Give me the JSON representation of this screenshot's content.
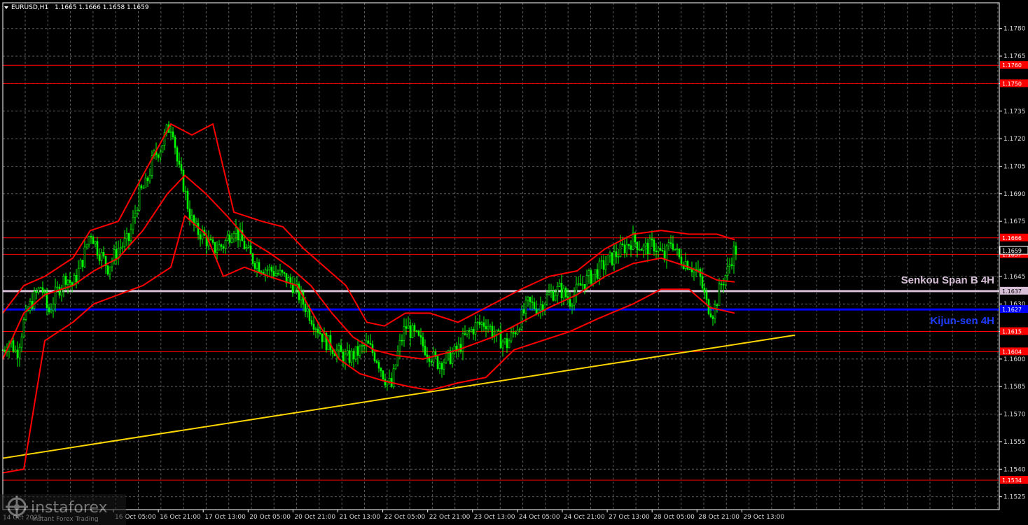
{
  "header": {
    "symbol": "EURUSD,H1",
    "ohlc": "1.1665 1.1666 1.1658 1.1659"
  },
  "watermark": {
    "brand": "instaforex",
    "tagline": "Instant Forex Trading",
    "partial_date": "14 Oct 2025"
  },
  "colors": {
    "background": "#000000",
    "grid": "#5a5a5a",
    "axis": "#ffffff",
    "candle_bull": "#00ff00",
    "candle_bear": "#00ff00",
    "bollinger": "#ff0000",
    "support_level": "#ff0000",
    "senkou": "#d8bfd8",
    "kijun": "#0000ff",
    "trendline": "#ffd700"
  },
  "chart_data": {
    "type": "candlestick",
    "symbol": "EURUSD",
    "timeframe": "H1",
    "title": "EURUSD,H1",
    "ylim": [
      1.1518,
      1.1794
    ],
    "y_ticks": [
      1.1525,
      1.154,
      1.1555,
      1.157,
      1.1585,
      1.16,
      1.1615,
      1.163,
      1.1645,
      1.166,
      1.1675,
      1.169,
      1.1705,
      1.172,
      1.1735,
      1.175,
      1.1765,
      1.178
    ],
    "x_ticks": [
      "16 Oct 05:00",
      "16 Oct 21:00",
      "17 Oct 13:00",
      "20 Oct 05:00",
      "20 Oct 21:00",
      "21 Oct 13:00",
      "22 Oct 05:00",
      "22 Oct 21:00",
      "23 Oct 13:00",
      "24 Oct 05:00",
      "24 Oct 21:00",
      "27 Oct 13:00",
      "28 Oct 05:00",
      "28 Oct 21:00",
      "29 Oct 13:00"
    ],
    "levels": [
      {
        "value": 1.176,
        "label": "1.1760",
        "kind": "support"
      },
      {
        "value": 1.175,
        "label": "1.1750",
        "kind": "support"
      },
      {
        "value": 1.1666,
        "label": "1.1666",
        "kind": "support"
      },
      {
        "value": 1.1657,
        "label": "1.1657",
        "kind": "support"
      },
      {
        "value": 1.1615,
        "label": "1.1615",
        "kind": "support"
      },
      {
        "value": 1.1604,
        "label": "1.1604",
        "kind": "support"
      },
      {
        "value": 1.1534,
        "label": "1.1534",
        "kind": "support"
      }
    ],
    "current_price": {
      "value": 1.1659,
      "label": "1.1659"
    },
    "senkou": {
      "value": 1.1637,
      "label": "1.1637",
      "name": "Senkou Span B 4H"
    },
    "kijun": {
      "value": 1.1627,
      "label": "1.1627",
      "name": "Kijun-sen 4H"
    },
    "trendline": {
      "start": {
        "x": 0.0,
        "y": 1.1546
      },
      "end": {
        "x": 0.795,
        "y": 1.1613
      }
    },
    "price_path": [
      [
        0,
        1.1605
      ],
      [
        10,
        1.161
      ],
      [
        20,
        1.1603
      ],
      [
        30,
        1.162
      ],
      [
        40,
        1.163
      ],
      [
        55,
        1.164
      ],
      [
        65,
        1.1625
      ],
      [
        75,
        1.1635
      ],
      [
        90,
        1.1645
      ],
      [
        100,
        1.164
      ],
      [
        115,
        1.1655
      ],
      [
        125,
        1.167
      ],
      [
        135,
        1.166
      ],
      [
        150,
        1.165
      ],
      [
        165,
        1.166
      ],
      [
        180,
        1.1665
      ],
      [
        195,
        1.169
      ],
      [
        205,
        1.1695
      ],
      [
        215,
        1.171
      ],
      [
        225,
        1.1715
      ],
      [
        235,
        1.1725
      ],
      [
        242,
        1.1728
      ],
      [
        250,
        1.1705
      ],
      [
        258,
        1.1695
      ],
      [
        266,
        1.168
      ],
      [
        275,
        1.167
      ],
      [
        285,
        1.1668
      ],
      [
        300,
        1.166
      ],
      [
        315,
        1.1662
      ],
      [
        330,
        1.1672
      ],
      [
        340,
        1.1665
      ],
      [
        355,
        1.1655
      ],
      [
        370,
        1.165
      ],
      [
        385,
        1.1648
      ],
      [
        400,
        1.1645
      ],
      [
        415,
        1.164
      ],
      [
        430,
        1.163
      ],
      [
        445,
        1.162
      ],
      [
        460,
        1.161
      ],
      [
        475,
        1.1605
      ],
      [
        490,
        1.16
      ],
      [
        505,
        1.1603
      ],
      [
        520,
        1.1608
      ],
      [
        535,
        1.16
      ],
      [
        545,
        1.159
      ],
      [
        555,
        1.1585
      ],
      [
        565,
        1.1605
      ],
      [
        575,
        1.1618
      ],
      [
        590,
        1.1612
      ],
      [
        605,
        1.1605
      ],
      [
        620,
        1.1598
      ],
      [
        635,
        1.16
      ],
      [
        650,
        1.1605
      ],
      [
        660,
        1.1612
      ],
      [
        675,
        1.1618
      ],
      [
        690,
        1.162
      ],
      [
        705,
        1.1612
      ],
      [
        720,
        1.1608
      ],
      [
        735,
        1.1618
      ],
      [
        750,
        1.163
      ],
      [
        765,
        1.1628
      ],
      [
        780,
        1.1635
      ],
      [
        795,
        1.1638
      ],
      [
        810,
        1.1632
      ],
      [
        825,
        1.164
      ],
      [
        840,
        1.1645
      ],
      [
        855,
        1.165
      ],
      [
        870,
        1.1655
      ],
      [
        885,
        1.166
      ],
      [
        900,
        1.1665
      ],
      [
        915,
        1.166
      ],
      [
        930,
        1.1662
      ],
      [
        945,
        1.1655
      ],
      [
        955,
        1.1665
      ],
      [
        965,
        1.1655
      ],
      [
        980,
        1.1652
      ],
      [
        995,
        1.1645
      ],
      [
        1005,
        1.163
      ],
      [
        1015,
        1.1625
      ],
      [
        1025,
        1.164
      ],
      [
        1035,
        1.1648
      ],
      [
        1045,
        1.166
      ],
      [
        1048,
        1.1659
      ]
    ],
    "bollinger_upper": [
      [
        0,
        1.1625
      ],
      [
        30,
        1.164
      ],
      [
        60,
        1.1645
      ],
      [
        100,
        1.1655
      ],
      [
        125,
        1.167
      ],
      [
        165,
        1.1675
      ],
      [
        200,
        1.17
      ],
      [
        240,
        1.1728
      ],
      [
        270,
        1.1722
      ],
      [
        300,
        1.1728
      ],
      [
        330,
        1.168
      ],
      [
        370,
        1.1675
      ],
      [
        400,
        1.1672
      ],
      [
        430,
        1.166
      ],
      [
        460,
        1.165
      ],
      [
        490,
        1.164
      ],
      [
        520,
        1.162
      ],
      [
        545,
        1.1618
      ],
      [
        575,
        1.1625
      ],
      [
        610,
        1.1625
      ],
      [
        650,
        1.162
      ],
      [
        700,
        1.163
      ],
      [
        740,
        1.1638
      ],
      [
        780,
        1.1645
      ],
      [
        820,
        1.1648
      ],
      [
        860,
        1.166
      ],
      [
        900,
        1.1668
      ],
      [
        940,
        1.167
      ],
      [
        980,
        1.1668
      ],
      [
        1020,
        1.1668
      ],
      [
        1045,
        1.1665
      ]
    ],
    "bollinger_middle": [
      [
        0,
        1.16
      ],
      [
        30,
        1.1625
      ],
      [
        60,
        1.1635
      ],
      [
        100,
        1.164
      ],
      [
        130,
        1.1648
      ],
      [
        165,
        1.1655
      ],
      [
        200,
        1.167
      ],
      [
        235,
        1.169
      ],
      [
        260,
        1.17
      ],
      [
        290,
        1.169
      ],
      [
        320,
        1.1678
      ],
      [
        350,
        1.1665
      ],
      [
        380,
        1.1658
      ],
      [
        410,
        1.165
      ],
      [
        440,
        1.164
      ],
      [
        470,
        1.1625
      ],
      [
        500,
        1.1612
      ],
      [
        530,
        1.1605
      ],
      [
        560,
        1.1602
      ],
      [
        600,
        1.16
      ],
      [
        650,
        1.1605
      ],
      [
        700,
        1.1612
      ],
      [
        740,
        1.162
      ],
      [
        780,
        1.1628
      ],
      [
        820,
        1.1635
      ],
      [
        860,
        1.1645
      ],
      [
        900,
        1.1652
      ],
      [
        940,
        1.1655
      ],
      [
        980,
        1.165
      ],
      [
        1020,
        1.1643
      ],
      [
        1045,
        1.1642
      ]
    ],
    "bollinger_lower": [
      [
        0,
        1.1538
      ],
      [
        30,
        1.154
      ],
      [
        60,
        1.161
      ],
      [
        100,
        1.162
      ],
      [
        130,
        1.163
      ],
      [
        165,
        1.1635
      ],
      [
        200,
        1.164
      ],
      [
        240,
        1.165
      ],
      [
        260,
        1.1678
      ],
      [
        290,
        1.1668
      ],
      [
        315,
        1.1645
      ],
      [
        345,
        1.165
      ],
      [
        380,
        1.1645
      ],
      [
        420,
        1.164
      ],
      [
        450,
        1.162
      ],
      [
        480,
        1.16
      ],
      [
        510,
        1.1592
      ],
      [
        545,
        1.1588
      ],
      [
        580,
        1.1585
      ],
      [
        610,
        1.1583
      ],
      [
        650,
        1.1587
      ],
      [
        690,
        1.159
      ],
      [
        730,
        1.1605
      ],
      [
        770,
        1.161
      ],
      [
        810,
        1.1615
      ],
      [
        850,
        1.1622
      ],
      [
        900,
        1.163
      ],
      [
        940,
        1.1638
      ],
      [
        980,
        1.1638
      ],
      [
        1010,
        1.1628
      ],
      [
        1045,
        1.1625
      ]
    ]
  }
}
